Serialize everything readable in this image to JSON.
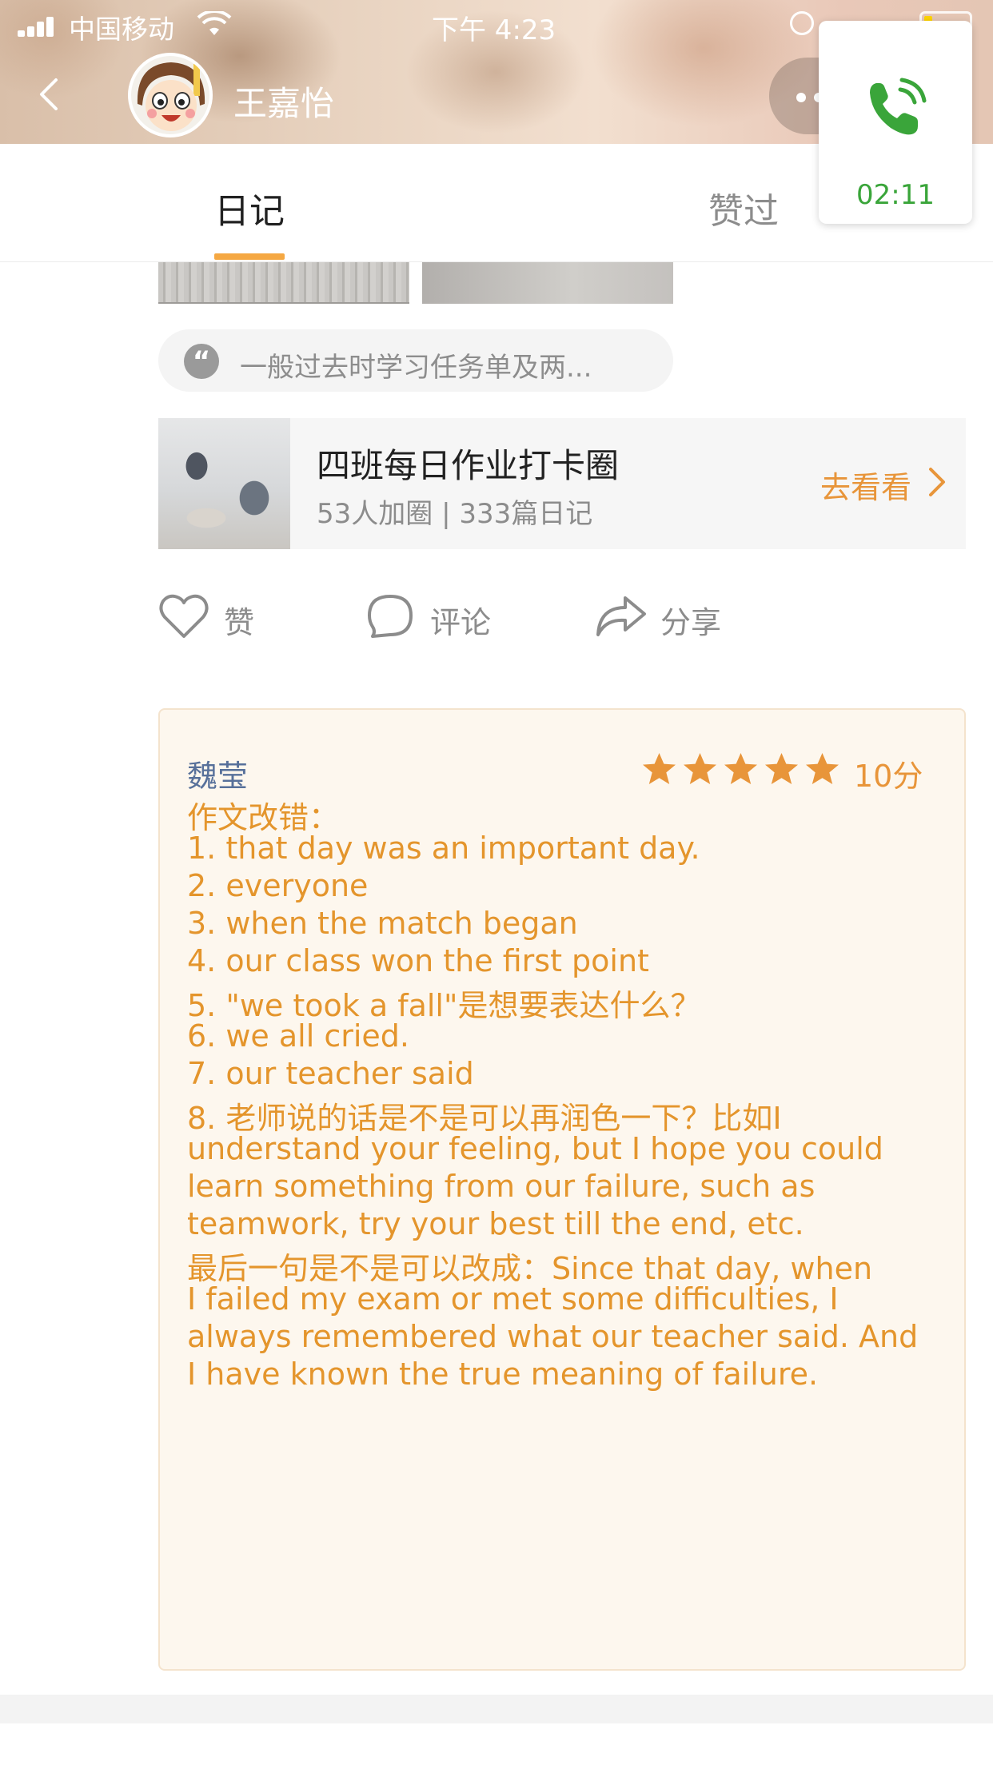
{
  "status_bar": {
    "carrier": "中国移动",
    "time": "下午 4:23"
  },
  "header": {
    "user_name": "王嘉怡"
  },
  "call_widget": {
    "duration": "02:11",
    "accent_color": "#3aa53a"
  },
  "tabs": [
    {
      "label": "日记",
      "selected": true
    },
    {
      "label": "赞过",
      "selected": false
    }
  ],
  "post": {
    "quote_preview": "一般过去时学习任务单及两...",
    "circle": {
      "name": "四班每日作业打卡圈",
      "meta": "53人加圈 | 333篇日记",
      "go_label": "去看看"
    },
    "actions": {
      "like": "赞",
      "comment": "评论",
      "share": "分享"
    }
  },
  "comment": {
    "author": "魏莹",
    "rating_stars": 5,
    "score": "10分",
    "lines": [
      "作文改错：",
      "1. that day was an important day.",
      "2. everyone",
      "3. when the match began",
      "4. our class won the first point",
      "5. \"we took a fall\"是想要表达什么？",
      "6. we all cried.",
      "7. our teacher said",
      "8. 老师说的话是不是可以再润色一下？比如I",
      "understand your feeling, but I hope you could",
      "learn something from our failure, such as",
      "teamwork, try your best till the end, etc.",
      "最后一句是不是可以改成：Since that day, when",
      "I failed my exam or met some difficulties, I",
      "always remembered what our teacher said. And",
      "I have known the true meaning of failure."
    ]
  },
  "colors": {
    "accent_orange": "#e8953a",
    "comment_text": "#e4952c",
    "author_blue": "#57709a",
    "tab_underline": "#f5a843"
  }
}
